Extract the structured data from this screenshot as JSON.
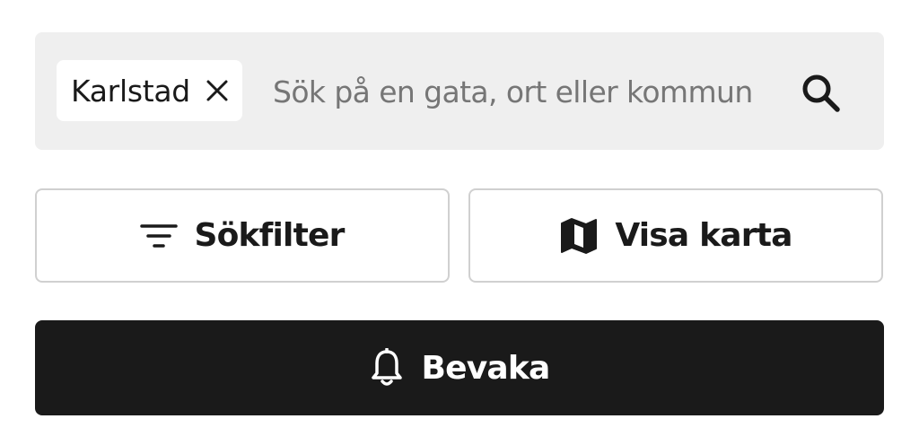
{
  "search": {
    "chip_label": "Karlstad",
    "chip_close_icon": "close-icon",
    "placeholder": "Sök på en gata, ort eller kommun",
    "value": "",
    "search_icon": "search-icon"
  },
  "actions": {
    "filter_label": "Sökfilter",
    "filter_icon": "filter-lines-icon",
    "map_label": "Visa karta",
    "map_icon": "map-icon"
  },
  "watch": {
    "label": "Bevaka",
    "icon": "bell-icon"
  },
  "colors": {
    "search_bg": "#efefef",
    "chip_bg": "#ffffff",
    "button_border": "#d0d0d0",
    "primary_bg": "#1a1a1a",
    "primary_text": "#ffffff",
    "placeholder_text": "#767676"
  }
}
